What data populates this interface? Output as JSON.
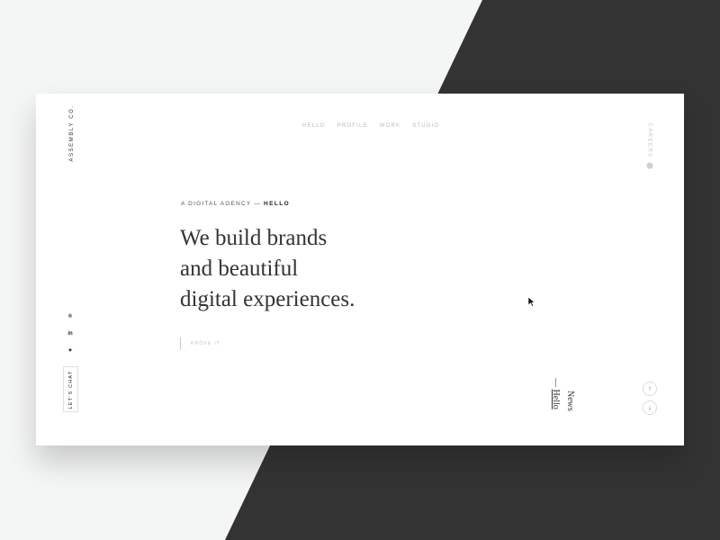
{
  "brand": "ASSEMBLY CO.",
  "nav": [
    "HELLO",
    "PROFILE",
    "WORK",
    "STUDIO"
  ],
  "careers": "CAREERS",
  "hero": {
    "eyebrow": "A DIGITAL AGENCY —",
    "eyebrow_strong": "HELLO",
    "lines": [
      "We build brands",
      "and beautiful",
      "digital experiences."
    ],
    "cta": "PROVE IT"
  },
  "social": [
    "®",
    "in",
    "✦"
  ],
  "chat": "LET'S CHAT",
  "slides": {
    "active_prefix": "— ",
    "active": "Hello",
    "next": "News"
  },
  "pager": {
    "prev": "↑",
    "next": "↓"
  },
  "colors": {
    "background": "#f4f5f5",
    "dark_panel": "#333333",
    "card": "#ffffff",
    "text": "#333333"
  }
}
